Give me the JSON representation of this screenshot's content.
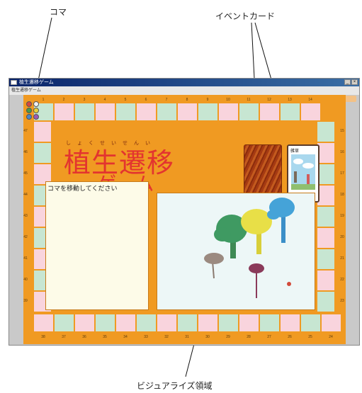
{
  "callouts": {
    "piece": "コマ",
    "event_card": "イベントカード",
    "visualize": "ビジュアライズ領域"
  },
  "window": {
    "title": "植生遷移ゲーム",
    "menu": "植生遷移ゲーム"
  },
  "game": {
    "title_main": "植生遷移",
    "title_sub": "ゲーム",
    "title_ruby": "しょくせいせんい",
    "message": "コマを移動してください",
    "card_label": "雑草"
  },
  "board": {
    "top_numbers": [
      "1",
      "2",
      "3",
      "4",
      "5",
      "6",
      "7",
      "8",
      "9",
      "10",
      "11",
      "12",
      "13",
      "14"
    ],
    "right_numbers": [
      "15",
      "16",
      "17",
      "18",
      "19",
      "20",
      "21",
      "22",
      "23"
    ],
    "bottom_numbers": [
      "38",
      "37",
      "36",
      "35",
      "34",
      "33",
      "32",
      "31",
      "30",
      "29",
      "28",
      "27",
      "26",
      "25",
      "24"
    ],
    "left_numbers": [
      "47",
      "46",
      "45",
      "44",
      "43",
      "42",
      "41",
      "40",
      "39"
    ]
  },
  "colors": {
    "board": "#f09a22",
    "pink_cell": "#f9d4dd",
    "green_cell": "#c7e6d2",
    "title": "#e3342f"
  }
}
